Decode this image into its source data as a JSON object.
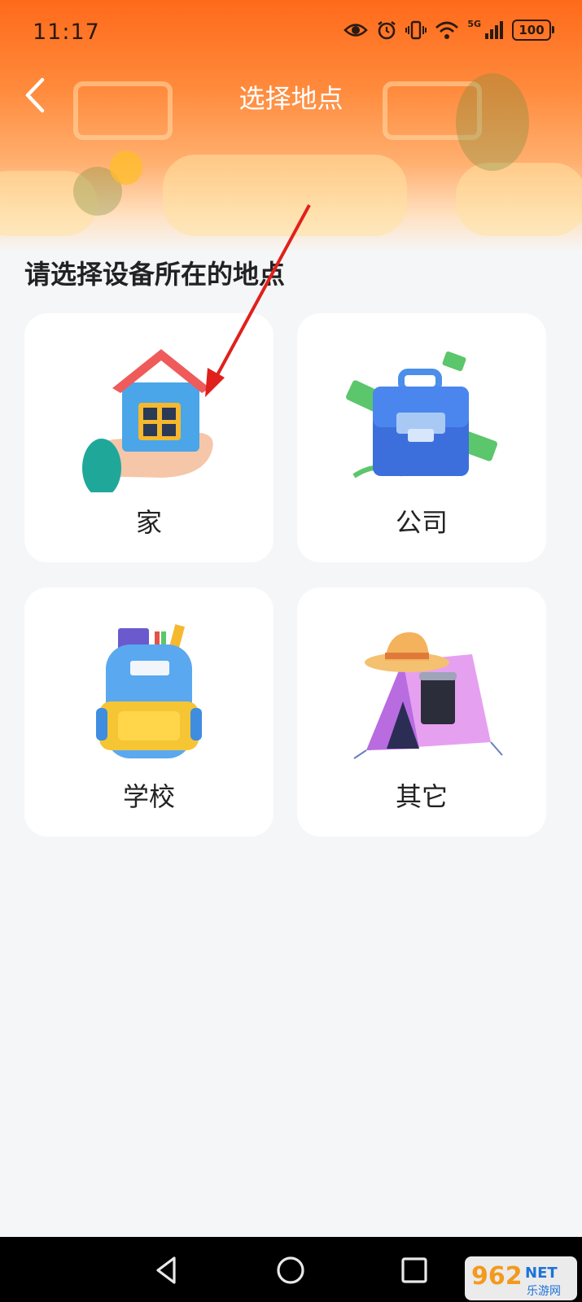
{
  "status_bar": {
    "time": "11:17",
    "network_label": "5G",
    "battery": "100",
    "icons": [
      "eye-icon",
      "alarm-icon",
      "vibrate-icon",
      "wifi-icon",
      "signal-icon",
      "battery-icon"
    ]
  },
  "header": {
    "title": "选择地点",
    "back_icon": "chevron-left-icon"
  },
  "prompt": "请选择设备所在的地点",
  "locations": [
    {
      "label": "家",
      "icon": "house-in-hand-icon"
    },
    {
      "label": "公司",
      "icon": "briefcase-icon"
    },
    {
      "label": "学校",
      "icon": "backpack-icon"
    },
    {
      "label": "其它",
      "icon": "tent-hat-icon"
    }
  ],
  "nav_bar": {
    "icons": [
      "back-triangle-icon",
      "home-circle-icon",
      "recents-square-icon"
    ]
  },
  "watermark": {
    "brand": "962",
    "suffix": "NET",
    "subtitle": "乐游网"
  },
  "colors": {
    "header_orange": "#ff6a1a",
    "card_bg": "#ffffff",
    "page_bg": "#f5f6f8",
    "annotation_red": "#e0201c"
  }
}
